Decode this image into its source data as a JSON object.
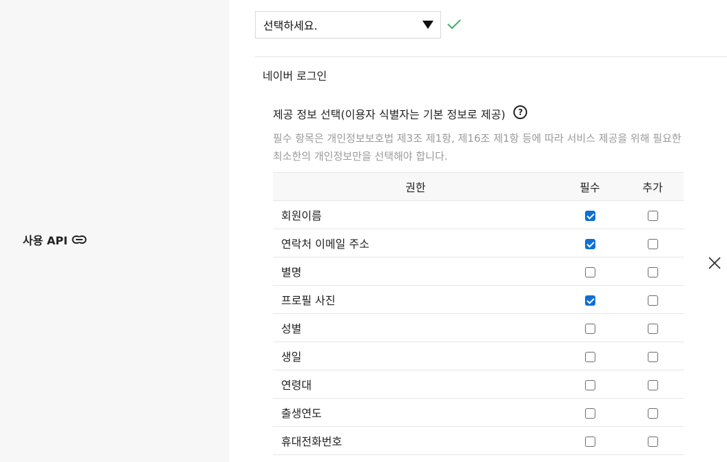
{
  "sidebar": {
    "api_label": "사용 API"
  },
  "service_select": {
    "value": "선택하세요."
  },
  "service": {
    "name": "네이버 로그인"
  },
  "info": {
    "title": "제공 정보 선택(이용자 식별자는 기본 정보로 제공)",
    "description": "필수 항목은 개인정보보호법 제3조 제1항, 제16조 제1항 등에 따라 서비스 제공을 위해 필요한 최소한의 개인정보만을 선택해야 합니다."
  },
  "table": {
    "headers": [
      "권한",
      "필수",
      "추가"
    ],
    "rows": [
      {
        "label": "회원이름",
        "required": true,
        "additional": false
      },
      {
        "label": "연락처 이메일 주소",
        "required": true,
        "additional": false
      },
      {
        "label": "별명",
        "required": false,
        "additional": false
      },
      {
        "label": "프로필 사진",
        "required": true,
        "additional": false
      },
      {
        "label": "성별",
        "required": false,
        "additional": false
      },
      {
        "label": "생일",
        "required": false,
        "additional": false
      },
      {
        "label": "연령대",
        "required": false,
        "additional": false
      },
      {
        "label": "출생연도",
        "required": false,
        "additional": false
      },
      {
        "label": "휴대전화번호",
        "required": false,
        "additional": false
      }
    ]
  },
  "icons": {
    "link": "link-icon",
    "valid": "check-icon",
    "help": "help-icon",
    "close": "close-icon"
  },
  "colors": {
    "check_green": "#4caf70",
    "checkbox_blue": "#0f6fd6"
  }
}
